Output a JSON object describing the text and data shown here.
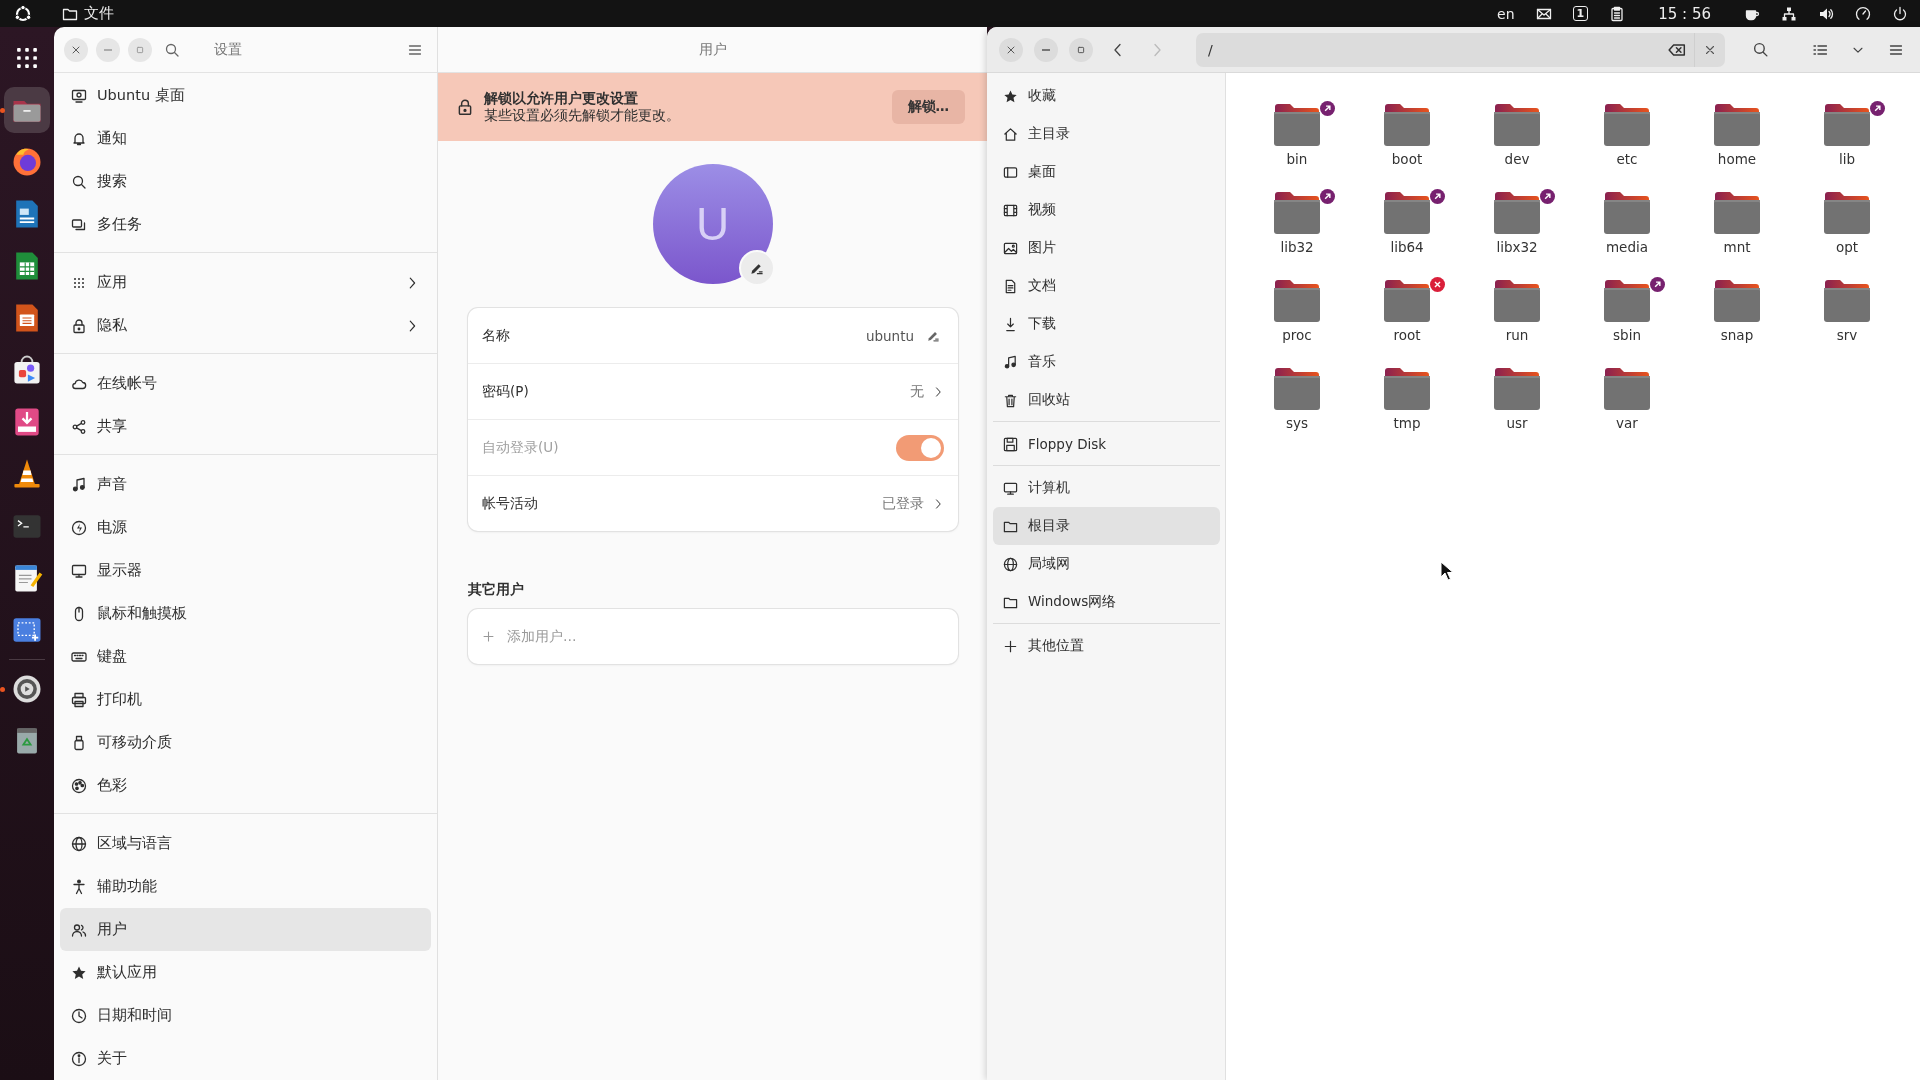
{
  "top_bar": {
    "app_menu": "文件",
    "keyboard_layout": "en",
    "workspace": "1",
    "clock": "15 : 56"
  },
  "dock": {
    "items": [
      {
        "running": false,
        "selected": false
      },
      {
        "running": true,
        "selected": true
      },
      {
        "running": false,
        "selected": false
      },
      {
        "running": false,
        "selected": false
      },
      {
        "running": false,
        "selected": false
      },
      {
        "running": false,
        "selected": false
      },
      {
        "running": false,
        "selected": false
      },
      {
        "running": false,
        "selected": false
      },
      {
        "running": false,
        "selected": false
      },
      {
        "running": false,
        "selected": false
      },
      {
        "running": false,
        "selected": false
      },
      {
        "running": false,
        "selected": false
      },
      {
        "running": true,
        "selected": false
      },
      {
        "running": false,
        "selected": false
      }
    ]
  },
  "settings": {
    "title": "设置",
    "page_title": "用户",
    "sidebar": {
      "groups": [
        {
          "items": [
            {
              "label": "Ubuntu 桌面",
              "kind": "page",
              "selected": false
            },
            {
              "label": "通知",
              "kind": "page",
              "selected": false
            },
            {
              "label": "搜索",
              "kind": "page",
              "selected": false
            },
            {
              "label": "多任务",
              "kind": "page",
              "selected": false
            }
          ]
        },
        {
          "items": [
            {
              "label": "应用",
              "kind": "submenu",
              "selected": false
            },
            {
              "label": "隐私",
              "kind": "submenu",
              "selected": false
            }
          ]
        },
        {
          "items": [
            {
              "label": "在线帐号",
              "kind": "page",
              "selected": false
            },
            {
              "label": "共享",
              "kind": "page",
              "selected": false
            }
          ]
        },
        {
          "items": [
            {
              "label": "声音",
              "kind": "page",
              "selected": false
            },
            {
              "label": "电源",
              "kind": "page",
              "selected": false
            },
            {
              "label": "显示器",
              "kind": "page",
              "selected": false
            },
            {
              "label": "鼠标和触摸板",
              "kind": "page",
              "selected": false
            },
            {
              "label": "键盘",
              "kind": "page",
              "selected": false
            },
            {
              "label": "打印机",
              "kind": "page",
              "selected": false
            },
            {
              "label": "可移动介质",
              "kind": "page",
              "selected": false
            },
            {
              "label": "色彩",
              "kind": "page",
              "selected": false
            }
          ]
        },
        {
          "items": [
            {
              "label": "区域与语言",
              "kind": "page",
              "selected": false
            },
            {
              "label": "辅助功能",
              "kind": "page",
              "selected": false
            },
            {
              "label": "用户",
              "kind": "page",
              "selected": true
            },
            {
              "label": "默认应用",
              "kind": "page",
              "selected": false
            },
            {
              "label": "日期和时间",
              "kind": "page",
              "selected": false
            },
            {
              "label": "关于",
              "kind": "page",
              "selected": false
            }
          ]
        }
      ]
    },
    "banner": {
      "title": "解锁以允许用户更改设置",
      "subtitle": "某些设置必须先解锁才能更改。",
      "button": "解锁…"
    },
    "avatar": {
      "initial": "U"
    },
    "account_rows": [
      {
        "kind": "editable",
        "label": "名称",
        "value": "ubuntu"
      },
      {
        "kind": "link",
        "label": "密码(P)",
        "value": "无"
      },
      {
        "kind": "switch",
        "label": "自动登录(U)",
        "on": true,
        "disabled": true
      },
      {
        "kind": "link",
        "label": "帐号活动",
        "value": "已登录"
      }
    ],
    "other_users": {
      "heading": "其它用户",
      "add_label": "添加用户…"
    }
  },
  "files": {
    "path": "/",
    "sidebar": {
      "groups": [
        {
          "items": [
            {
              "label": "收藏",
              "selected": false
            },
            {
              "label": "主目录",
              "selected": false
            },
            {
              "label": "桌面",
              "selected": false
            },
            {
              "label": "视频",
              "selected": false
            },
            {
              "label": "图片",
              "selected": false
            },
            {
              "label": "文档",
              "selected": false
            },
            {
              "label": "下载",
              "selected": false
            },
            {
              "label": "音乐",
              "selected": false
            },
            {
              "label": "回收站",
              "selected": false
            }
          ]
        },
        {
          "items": [
            {
              "label": "Floppy Disk",
              "selected": false
            }
          ]
        },
        {
          "items": [
            {
              "label": "计算机",
              "selected": false
            },
            {
              "label": "根目录",
              "selected": true
            },
            {
              "label": "局域网",
              "selected": false
            },
            {
              "label": "Windows网络",
              "selected": false
            }
          ]
        },
        {
          "items": [
            {
              "label": "其他位置",
              "selected": false
            }
          ]
        }
      ]
    },
    "items": [
      {
        "name": "bin",
        "symlink": true,
        "inaccessible": false
      },
      {
        "name": "boot",
        "symlink": false,
        "inaccessible": false
      },
      {
        "name": "dev",
        "symlink": false,
        "inaccessible": false
      },
      {
        "name": "etc",
        "symlink": false,
        "inaccessible": false
      },
      {
        "name": "home",
        "symlink": false,
        "inaccessible": false
      },
      {
        "name": "lib",
        "symlink": true,
        "inaccessible": false
      },
      {
        "name": "lib32",
        "symlink": true,
        "inaccessible": false
      },
      {
        "name": "lib64",
        "symlink": true,
        "inaccessible": false
      },
      {
        "name": "libx32",
        "symlink": true,
        "inaccessible": false
      },
      {
        "name": "media",
        "symlink": false,
        "inaccessible": false
      },
      {
        "name": "mnt",
        "symlink": false,
        "inaccessible": false
      },
      {
        "name": "opt",
        "symlink": false,
        "inaccessible": false
      },
      {
        "name": "proc",
        "symlink": false,
        "inaccessible": false
      },
      {
        "name": "root",
        "symlink": false,
        "inaccessible": true
      },
      {
        "name": "run",
        "symlink": false,
        "inaccessible": false
      },
      {
        "name": "sbin",
        "symlink": true,
        "inaccessible": false
      },
      {
        "name": "snap",
        "symlink": false,
        "inaccessible": false
      },
      {
        "name": "srv",
        "symlink": false,
        "inaccessible": false
      },
      {
        "name": "sys",
        "symlink": false,
        "inaccessible": false
      },
      {
        "name": "tmp",
        "symlink": false,
        "inaccessible": false
      },
      {
        "name": "usr",
        "symlink": false,
        "inaccessible": false
      },
      {
        "name": "var",
        "symlink": false,
        "inaccessible": false
      }
    ]
  }
}
